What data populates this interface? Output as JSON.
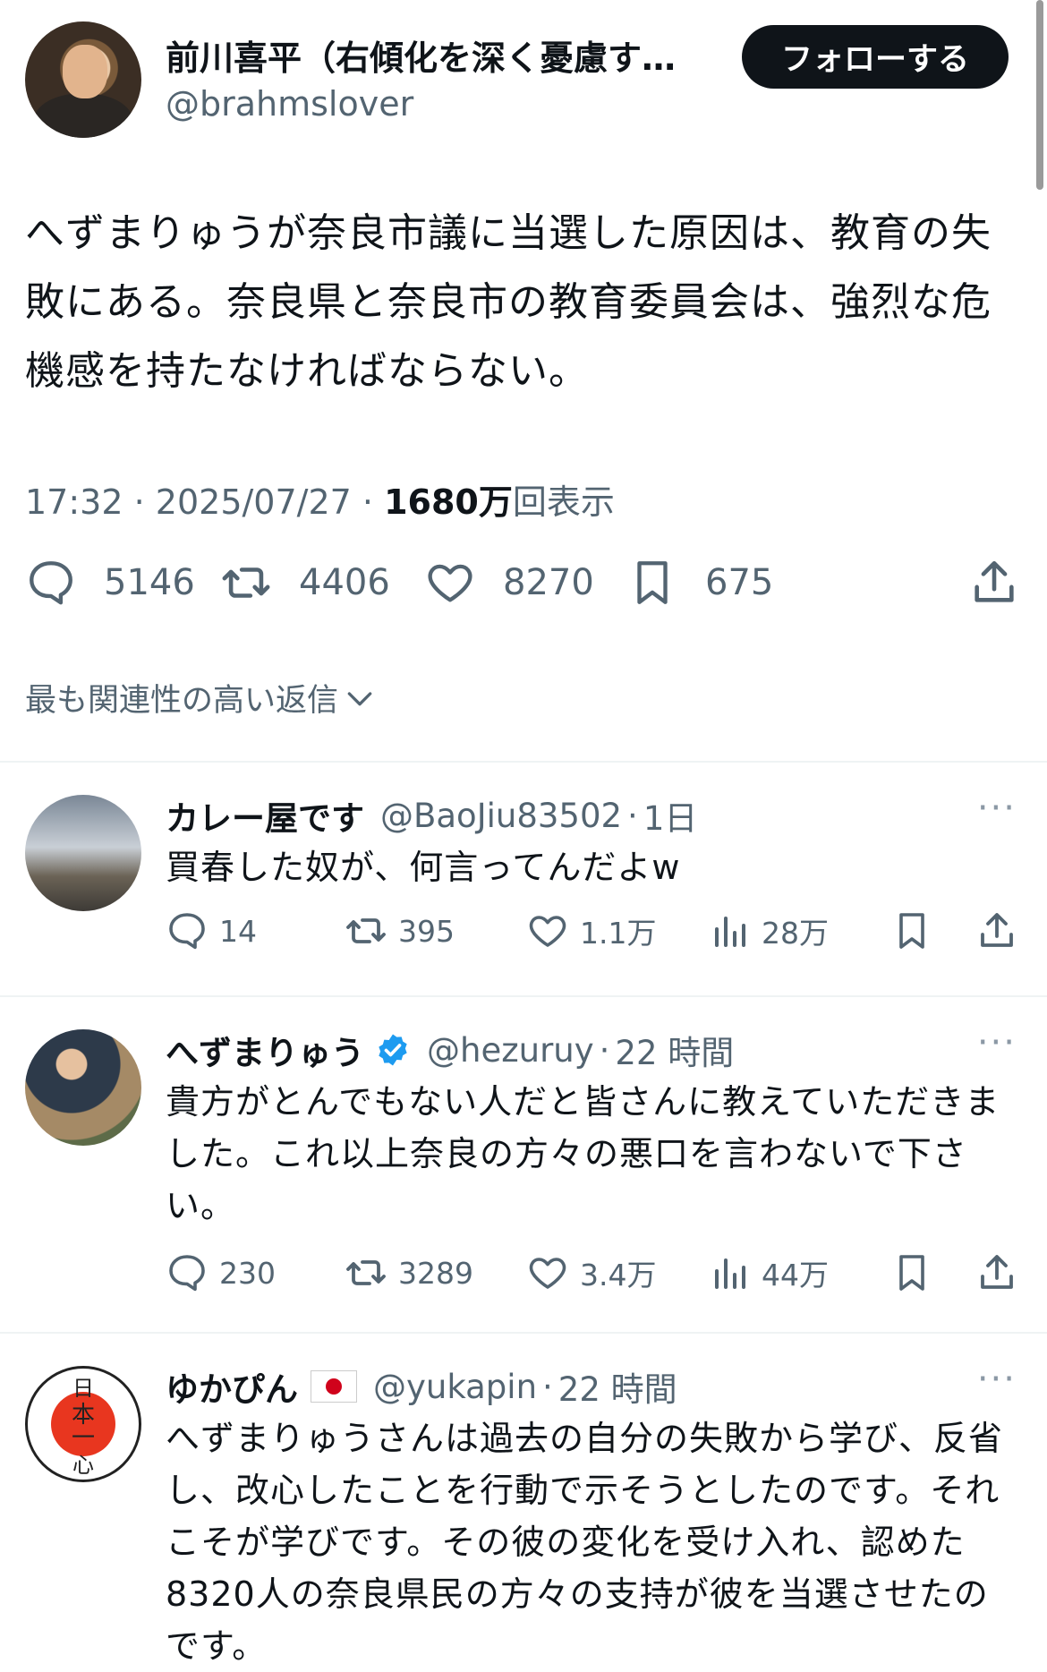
{
  "main_tweet": {
    "name": "前川喜平（右傾化を深く憂慮す…",
    "handle": "@brahmslover",
    "follow_label": "フォローする",
    "text": "へずまりゅうが奈良市議に当選した原因は、教育の失敗にある。奈良県と奈良市の教育委員会は、強烈な危機感を持たなければならない。",
    "time": "17:32",
    "date": "2025/07/27",
    "views_count": "1680万",
    "views_label": "回表示",
    "separator": "·",
    "replies": "5146",
    "retweets": "4406",
    "likes": "8270",
    "bookmarks": "675"
  },
  "sort_label": "最も関連性の高い返信",
  "replies": [
    {
      "name": "カレー屋です",
      "handle": "@BaoJiu83502",
      "time": "1日",
      "text": "買春した奴が、何言ってんだよw",
      "replies": "14",
      "retweets": "395",
      "likes": "1.1万",
      "views": "28万"
    },
    {
      "name": "へずまりゅう",
      "handle": "@hezuruy",
      "time": "22 時間",
      "text": "貴方がとんでもない人だと皆さんに教えていただきました。これ以上奈良の方々の悪口を言わないで下さい。",
      "replies": "230",
      "retweets": "3289",
      "likes": "3.4万",
      "views": "44万"
    },
    {
      "name": "ゆかぴん",
      "handle": "@yukapin",
      "time": "22 時間",
      "text": "へずまりゅうさんは過去の自分の失敗から学び、反省し、改心したことを行動で示そうとしたのです。それこそが学びです。その彼の変化を受け入れ、認めた8320人の奈良県民の方々の支持が彼を当選させたのです。",
      "avatar_text": "日本一心"
    }
  ],
  "more_label": "···",
  "colors": {
    "text": "#0f1419",
    "secondary": "#536471",
    "verified": "#1d9bf0",
    "flag_red": "#d0021b"
  }
}
